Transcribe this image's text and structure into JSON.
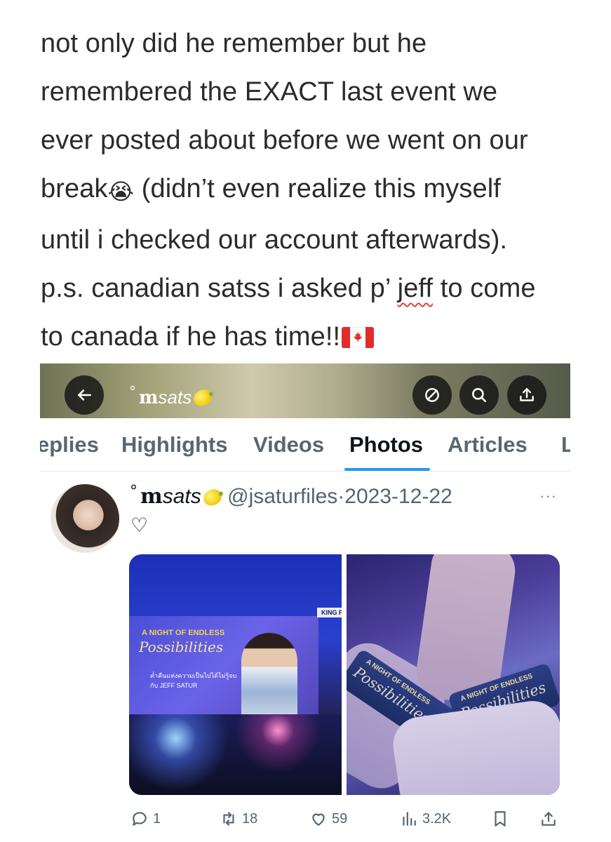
{
  "caption": {
    "lines": [
      "not only did he remember but he",
      "remembered the EXACT last event we",
      "ever posted about before we went on our"
    ],
    "line4_a": "break",
    "line4_emoji": "😭",
    "line4_b": " (didn’t even realize this myself",
    "line5": "until i checked our account afterwards).",
    "line6_a": "p.s. canadian satss i asked p’ ",
    "line6_underlined": "jeff",
    "line6_b": " to come",
    "line7": "to canada if he has time!!",
    "flag": "canada-flag"
  },
  "screenshot": {
    "topbar": {
      "degree": "°",
      "name_bold": "m",
      "name_italic": "sats",
      "name_emoji": "lemon",
      "back_icon": "arrow-left-icon",
      "icons": [
        "no-symbol-icon",
        "search-icon",
        "share-icon"
      ]
    },
    "tabs": [
      "eplies",
      "Highlights",
      "Videos",
      "Photos",
      "Articles",
      "L"
    ],
    "active_tab": "Photos",
    "accent": "#1d9bf0",
    "post": {
      "degree": "°",
      "name_bold": "m",
      "name_italic": "sats",
      "handle": "@jsaturfiles",
      "separator": "·",
      "date": "2023-12-22",
      "more": "···",
      "text": "♡",
      "photo1": {
        "title_top": "A NIGHT OF ENDLESS",
        "title_main": "Possibilities",
        "subtitle_thai": "ค่ำคืนแห่งความเป็นไปได้ไม่รู้จบ",
        "subtitle_en": "กับ JEFF SATUR",
        "corner": "KING P"
      },
      "photo2": {
        "band_top": "A NIGHT OF ENDLESS",
        "band_main": "Possibilities"
      },
      "actions": {
        "reply": "1",
        "repost": "18",
        "like": "59",
        "views": "3.2K"
      }
    }
  }
}
